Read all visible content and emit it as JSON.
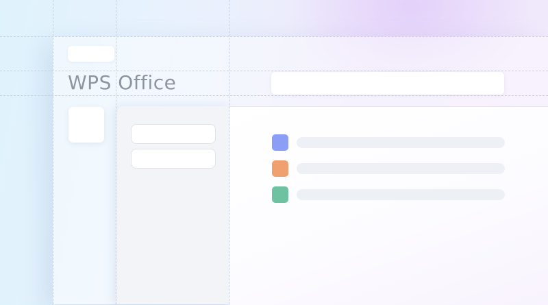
{
  "app": {
    "logo_text": "WPS Office"
  },
  "search": {
    "placeholder": ""
  },
  "files": [
    {
      "icon": "document-icon",
      "color": "#8a9ef6"
    },
    {
      "icon": "presentation-icon",
      "color": "#f0a06e"
    },
    {
      "icon": "spreadsheet-icon",
      "color": "#6fc2a1"
    }
  ],
  "colors": {
    "logo": "#8e959e",
    "sidebar": "#f2f4f8",
    "bar_placeholder": "#edf1f5"
  }
}
